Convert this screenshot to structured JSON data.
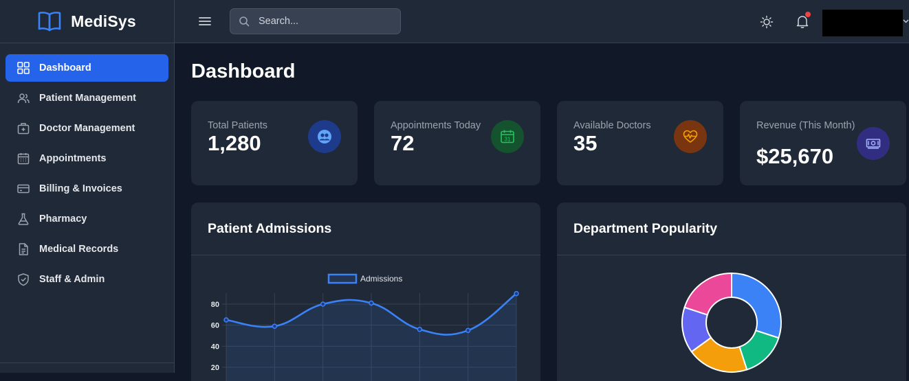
{
  "app": {
    "name": "MediSys"
  },
  "sidebar": {
    "items": [
      {
        "label": "Dashboard",
        "icon": "grid-icon",
        "active": true
      },
      {
        "label": "Patient Management",
        "icon": "users-icon",
        "active": false
      },
      {
        "label": "Doctor Management",
        "icon": "medical-bag-icon",
        "active": false
      },
      {
        "label": "Appointments",
        "icon": "calendar-icon",
        "active": false
      },
      {
        "label": "Billing & Invoices",
        "icon": "credit-card-icon",
        "active": false
      },
      {
        "label": "Pharmacy",
        "icon": "flask-icon",
        "active": false
      },
      {
        "label": "Medical Records",
        "icon": "document-icon",
        "active": false
      },
      {
        "label": "Staff & Admin",
        "icon": "shield-icon",
        "active": false
      }
    ]
  },
  "topbar": {
    "search_placeholder": "Search...",
    "notifications_unread": true
  },
  "page": {
    "title": "Dashboard"
  },
  "stats": [
    {
      "label": "Total Patients",
      "value": "1,280",
      "icon": "users-circle-icon",
      "color": "#3b82f6",
      "bg": "#1e3a8a"
    },
    {
      "label": "Appointments Today",
      "value": "72",
      "icon": "calendar-icon",
      "color": "#22c55e",
      "bg": "#14532d"
    },
    {
      "label": "Available Doctors",
      "value": "35",
      "icon": "heartbeat-icon",
      "color": "#f59e0b",
      "bg": "#78350f"
    },
    {
      "label": "Revenue (This Month)",
      "value": "$25,670",
      "icon": "money-icon",
      "color": "#818cf8",
      "bg": "#312e81"
    }
  ],
  "panels": {
    "admissions_title": "Patient Admissions",
    "department_title": "Department Popularity"
  },
  "chart_data": [
    {
      "type": "line",
      "title": "Patient Admissions",
      "series": [
        {
          "name": "Admissions",
          "color": "#3b82f6",
          "values": [
            65,
            59,
            80,
            81,
            56,
            55,
            90
          ]
        }
      ],
      "y_ticks": [
        20,
        40,
        60,
        80
      ],
      "ylim": [
        0,
        90
      ],
      "grid": true,
      "legend": "top-center",
      "fill": true
    },
    {
      "type": "pie",
      "title": "Department Popularity",
      "donut": true,
      "slices": [
        {
          "value": 30,
          "color": "#3b82f6"
        },
        {
          "value": 15,
          "color": "#10b981"
        },
        {
          "value": 20,
          "color": "#f59e0b"
        },
        {
          "value": 15,
          "color": "#6366f1"
        },
        {
          "value": 20,
          "color": "#ec4899"
        }
      ]
    }
  ]
}
